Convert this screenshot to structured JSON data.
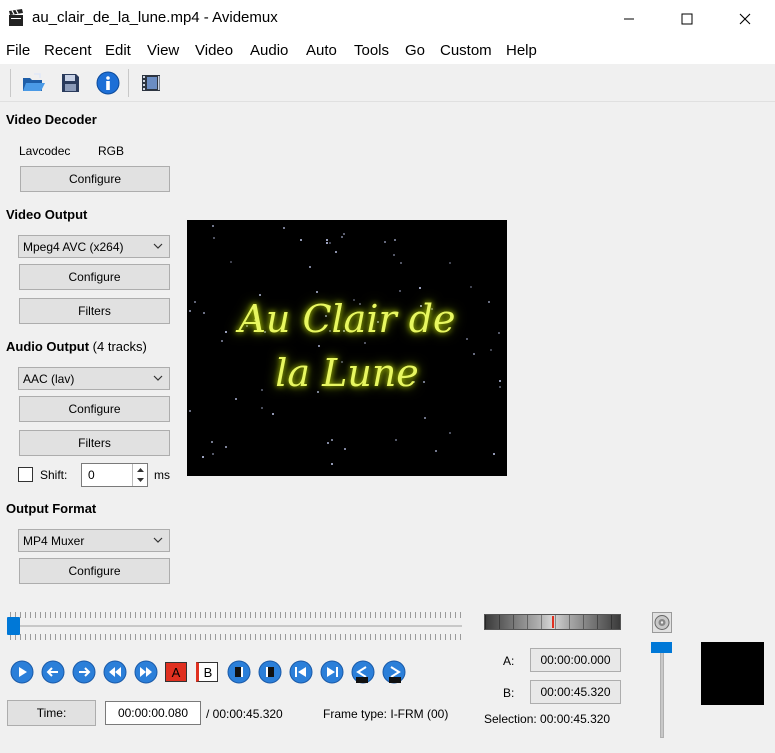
{
  "window": {
    "title": "au_clair_de_la_lune.mp4 - Avidemux"
  },
  "menu": [
    "File",
    "Recent",
    "Edit",
    "View",
    "Video",
    "Audio",
    "Auto",
    "Tools",
    "Go",
    "Custom",
    "Help"
  ],
  "toolbar": {
    "icons": [
      "open-icon",
      "save-icon",
      "info-icon",
      "film-icon"
    ]
  },
  "video_decoder": {
    "title": "Video Decoder",
    "codec": "Lavcodec",
    "colorspace": "RGB",
    "configure_label": "Configure"
  },
  "video_output": {
    "title": "Video Output",
    "selected": "Mpeg4 AVC (x264)",
    "configure_label": "Configure",
    "filters_label": "Filters"
  },
  "audio_output": {
    "title": "Audio Output",
    "tracks": "(4 tracks)",
    "selected": "AAC (lav)",
    "configure_label": "Configure",
    "filters_label": "Filters",
    "shift_label": "Shift:",
    "shift_value": "0",
    "shift_unit": "ms"
  },
  "output_format": {
    "title": "Output Format",
    "selected": "MP4 Muxer",
    "configure_label": "Configure"
  },
  "preview": {
    "line1": "Au Clair de",
    "line2": "la Lune"
  },
  "timeline": {
    "position_fraction": 0.0
  },
  "controls": {
    "time_button": "Time:",
    "current_time": "00:00:00.080",
    "total_time": "/ 00:00:45.320",
    "frame_type": "Frame type:  I-FRM (00)"
  },
  "markers": {
    "a_label": "A:",
    "a_time": "00:00:00.000",
    "b_label": "B:",
    "b_time": "00:00:45.320",
    "selection": "Selection: 00:00:45.320",
    "a_button": "A",
    "b_button": "B"
  },
  "colors": {
    "accent": "#0078d7",
    "marker_a": "#e03020"
  }
}
